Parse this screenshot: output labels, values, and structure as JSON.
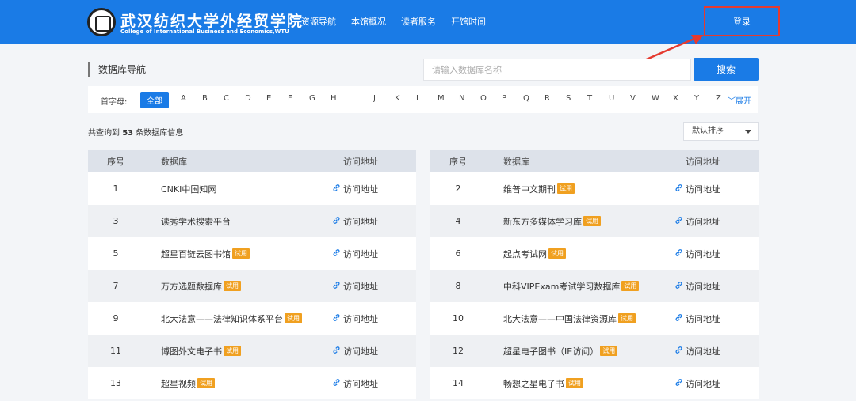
{
  "header": {
    "brand_cn": "武汉纺织大学外经贸学院",
    "brand_en": "College of International Business and Economics,WTU",
    "nav": [
      "资源导航",
      "本馆概况",
      "读者服务",
      "开馆时间"
    ],
    "login_label": "登录",
    "accent_color": "#1a7be6",
    "highlight_color": "#e53a2f"
  },
  "section": {
    "title": "数据库导航"
  },
  "search": {
    "placeholder": "请输入数据库名称",
    "button_label": "搜索"
  },
  "letter_bar": {
    "label": "首字母:",
    "all_label": "全部",
    "letters": [
      "A",
      "B",
      "C",
      "D",
      "E",
      "F",
      "G",
      "H",
      "I",
      "J",
      "K",
      "L",
      "M",
      "N",
      "O",
      "P",
      "Q",
      "R",
      "S",
      "T",
      "U",
      "V",
      "W",
      "X",
      "Y",
      "Z"
    ],
    "expand_label": "展开"
  },
  "results": {
    "prefix": "共查询到",
    "count": "53",
    "suffix": "条数据库信息"
  },
  "sort": {
    "selected": "默认排序"
  },
  "table": {
    "headers": {
      "no": "序号",
      "name": "数据库",
      "link": "访问地址"
    },
    "link_label": "访问地址",
    "trial_label": "试用",
    "left_rows": [
      {
        "no": "1",
        "name": "CNKI中国知网",
        "trial": false
      },
      {
        "no": "3",
        "name": "读秀学术搜索平台",
        "trial": false
      },
      {
        "no": "5",
        "name": "超星百链云图书馆",
        "trial": true
      },
      {
        "no": "7",
        "name": "万方选题数据库",
        "trial": true
      },
      {
        "no": "9",
        "name": "北大法意——法律知识体系平台",
        "trial": true
      },
      {
        "no": "11",
        "name": "博图外文电子书",
        "trial": true
      },
      {
        "no": "13",
        "name": "超星视频",
        "trial": true
      }
    ],
    "right_rows": [
      {
        "no": "2",
        "name": "维普中文期刊",
        "trial": true
      },
      {
        "no": "4",
        "name": "新东方多媒体学习库",
        "trial": true
      },
      {
        "no": "6",
        "name": "起点考试网",
        "trial": true
      },
      {
        "no": "8",
        "name": "中科VIPExam考试学习数据库",
        "trial": true
      },
      {
        "no": "10",
        "name": "北大法意——中国法律资源库",
        "trial": true
      },
      {
        "no": "12",
        "name": "超星电子图书（IE访问）",
        "trial": true
      },
      {
        "no": "14",
        "name": "畅想之星电子书",
        "trial": true
      }
    ]
  }
}
